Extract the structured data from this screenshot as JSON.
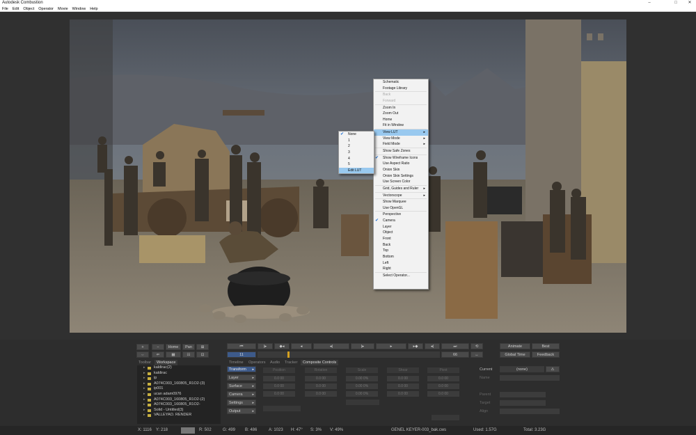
{
  "window": {
    "title": "Autodesk Combustion",
    "controls": [
      "–",
      "□",
      "✕"
    ]
  },
  "menubar": [
    "File",
    "Edit",
    "Object",
    "Operator",
    "Movie",
    "Window",
    "Help"
  ],
  "context_menu": {
    "items": [
      {
        "label": "Schematic"
      },
      {
        "label": "Footage Library"
      },
      {
        "sep": true
      },
      {
        "label": "Back",
        "disabled": true
      },
      {
        "label": "Forward",
        "disabled": true
      },
      {
        "sep": true
      },
      {
        "label": "Zoom In"
      },
      {
        "label": "Zoom Out"
      },
      {
        "label": "Home"
      },
      {
        "label": "Fit in Window"
      },
      {
        "sep": true
      },
      {
        "label": "View LUT",
        "sub": true,
        "highlight": true
      },
      {
        "label": "View Mode",
        "sub": true
      },
      {
        "label": "Field Mode",
        "sub": true
      },
      {
        "sep": true
      },
      {
        "label": "Show Safe Zones"
      },
      {
        "sep": true
      },
      {
        "label": "Show Wireframe Icons",
        "checked": true
      },
      {
        "label": "Use Aspect Ratio"
      },
      {
        "label": "Onion Skin"
      },
      {
        "label": "Onion Skin Settings"
      },
      {
        "label": "Use Screen Color"
      },
      {
        "sep": true
      },
      {
        "label": "Grid, Guides and Ruler",
        "sub": true
      },
      {
        "sep": true
      },
      {
        "label": "Vectorscope",
        "sub": true
      },
      {
        "sep": true
      },
      {
        "label": "Show Marquee"
      },
      {
        "label": "Use OpenGL"
      },
      {
        "sep": true
      },
      {
        "label": "Perspective"
      },
      {
        "label": "Camera",
        "checked": true
      },
      {
        "label": "Layer"
      },
      {
        "label": "Object"
      },
      {
        "label": "Front"
      },
      {
        "label": "Back"
      },
      {
        "label": "Top"
      },
      {
        "label": "Bottom"
      },
      {
        "label": "Left"
      },
      {
        "label": "Right"
      },
      {
        "sep": true
      },
      {
        "label": "Select Operator..."
      }
    ]
  },
  "lut_submenu": {
    "items": [
      {
        "label": "None",
        "checked": true
      },
      {
        "label": "1"
      },
      {
        "label": "2"
      },
      {
        "label": "3"
      },
      {
        "label": "4"
      },
      {
        "label": "5"
      },
      {
        "label": "Edit LUT",
        "highlight": true
      }
    ]
  },
  "view_controls": {
    "plus": "+",
    "minus": "−",
    "home": "Home",
    "pan": "Pan"
  },
  "transport": {
    "frame": "11",
    "end_frame": "66"
  },
  "right_buttons": {
    "animate": "Animate",
    "best": "Best",
    "global_time": "Global Time",
    "feedback": "Feedback"
  },
  "left_tabs": [
    "Toolbar",
    "Workspace"
  ],
  "tree": [
    {
      "label": "kaldirac(2)"
    },
    {
      "label": "kaldirac"
    },
    {
      "label": "ip"
    },
    {
      "label": "A074C003_160805_R1O2-(3)"
    },
    {
      "label": "ip001"
    },
    {
      "label": "ucan adam0976"
    },
    {
      "label": "A074C003_160805_R1O2-(2)"
    },
    {
      "label": "A074C003_160805_R1O2-"
    },
    {
      "label": "Solid - Untitled(3)"
    },
    {
      "label": "VALLEYAO. RENDER"
    }
  ],
  "bottom_tabs": [
    "Timeline",
    "Operators",
    "Audio",
    "Tracker",
    "Composite Controls"
  ],
  "side_buttons": [
    "Transform",
    "Layer",
    "Surface",
    "Camera",
    "Settings",
    "Output"
  ],
  "param_columns": [
    "Position",
    "Rotation",
    "Scale",
    "Shear",
    "Pivot"
  ],
  "param_values": [
    "0.0 00",
    "0.0 00",
    "0.00 0%",
    "0.0 00",
    "0.0 00"
  ],
  "current": {
    "label": "Current",
    "value": "(none)",
    "name_label": "Name",
    "parent_label": "Parent",
    "target_label": "Target",
    "align_label": "Align"
  },
  "status": {
    "x": "X: 1116",
    "y": "Y: 218",
    "r": "R: 502",
    "g": "G: 499",
    "b": "B: 486",
    "a": "A: 1023",
    "h": "H: 47°",
    "s": "S: 3%",
    "v": "V: 49%",
    "file": "GENEL KEYER-003_bak.cws",
    "used": "Used: 1.57G",
    "total": "Total: 3.23G"
  }
}
